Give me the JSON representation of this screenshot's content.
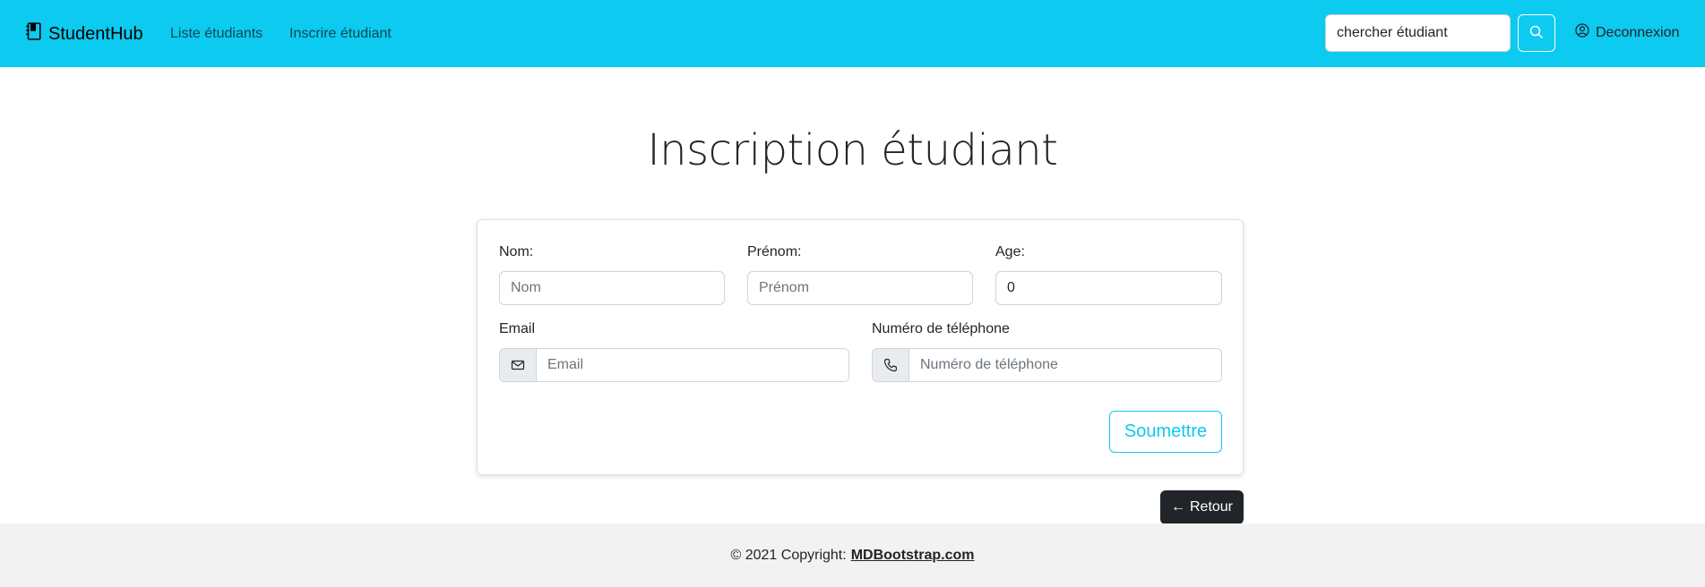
{
  "navbar": {
    "brand": "StudentHub",
    "brand_icon": "book-icon",
    "links": [
      "Liste étudiants",
      "Inscrire étudiant"
    ],
    "search_value": "chercher étudiant",
    "search_icon": "search-icon",
    "logout_label": "Deconnexion",
    "logout_icon": "user-circle-icon",
    "bg_color": "#0dcaf0"
  },
  "main": {
    "title": "Inscription étudiant"
  },
  "form": {
    "nom_label": "Nom:",
    "nom_placeholder": "Nom",
    "prenom_label": "Prénom:",
    "prenom_placeholder": "Prénom",
    "age_label": "Age:",
    "age_value": "0",
    "email_label": "Email",
    "email_placeholder": "Email",
    "email_icon": "envelope-icon",
    "phone_label": "Numéro de téléphone",
    "phone_placeholder": "Numéro de téléphone",
    "phone_icon": "phone-icon",
    "submit_label": "Soumettre"
  },
  "back_button": {
    "label": "Retour",
    "arrow": "←"
  },
  "footer": {
    "copyright": "© 2021 Copyright:",
    "link": "MDBootstrap.com"
  }
}
